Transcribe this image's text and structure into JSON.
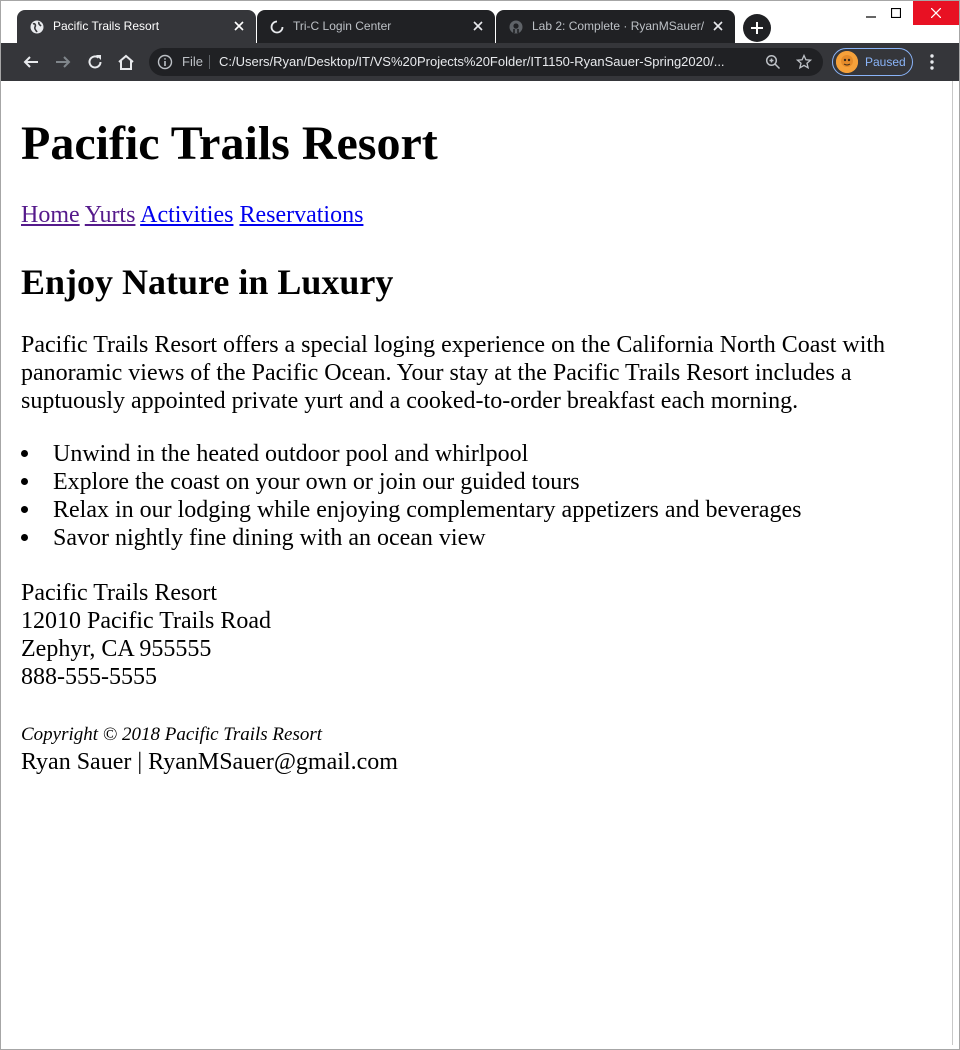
{
  "browser": {
    "tabs": [
      {
        "title": "Pacific Trails Resort",
        "active": true,
        "favicon": "globe-icon"
      },
      {
        "title": "Tri-C Login Center",
        "active": false,
        "favicon": "loading-spinner-icon"
      },
      {
        "title": "Lab 2: Complete · RyanMSauer/IT",
        "active": false,
        "favicon": "github-icon"
      }
    ],
    "omnibox": {
      "scheme_label": "File",
      "url": "C:/Users/Ryan/Desktop/IT/VS%20Projects%20Folder/IT1150-RyanSauer-Spring2020/..."
    },
    "profile": {
      "status": "Paused"
    },
    "colors": {
      "tab_active": "#35363a",
      "tab_inactive": "#202124",
      "toolbar": "#35363a",
      "accent": "#8ab4f8"
    }
  },
  "page": {
    "title": "Pacific Trails Resort",
    "nav": [
      {
        "label": "Home",
        "visited": true
      },
      {
        "label": "Yurts",
        "visited": true
      },
      {
        "label": "Activities",
        "visited": false
      },
      {
        "label": "Reservations",
        "visited": false
      }
    ],
    "heading": "Enjoy Nature in Luxury",
    "intro": "Pacific Trails Resort offers a special loging experience on the California North Coast with panoramic views of the Pacific Ocean. Your stay at the Pacific Trails Resort includes a suptuously appointed private yurt and a cooked-to-order breakfast each morning.",
    "features": [
      "Unwind in the heated outdoor pool and whirlpool",
      "Explore the coast on your own or join our guided tours",
      "Relax in our lodging while enjoying complementary appetizers and beverages",
      "Savor nightly fine dining with an ocean view"
    ],
    "address": {
      "name": "Pacific Trails Resort",
      "street": "12010 Pacific Trails Road",
      "city_state_zip": "Zephyr, CA 955555",
      "phone": "888-555-5555"
    },
    "footer": {
      "copyright": "Copyright © 2018 Pacific Trails Resort",
      "author": "Ryan Sauer | RyanMSauer@gmail.com"
    }
  }
}
